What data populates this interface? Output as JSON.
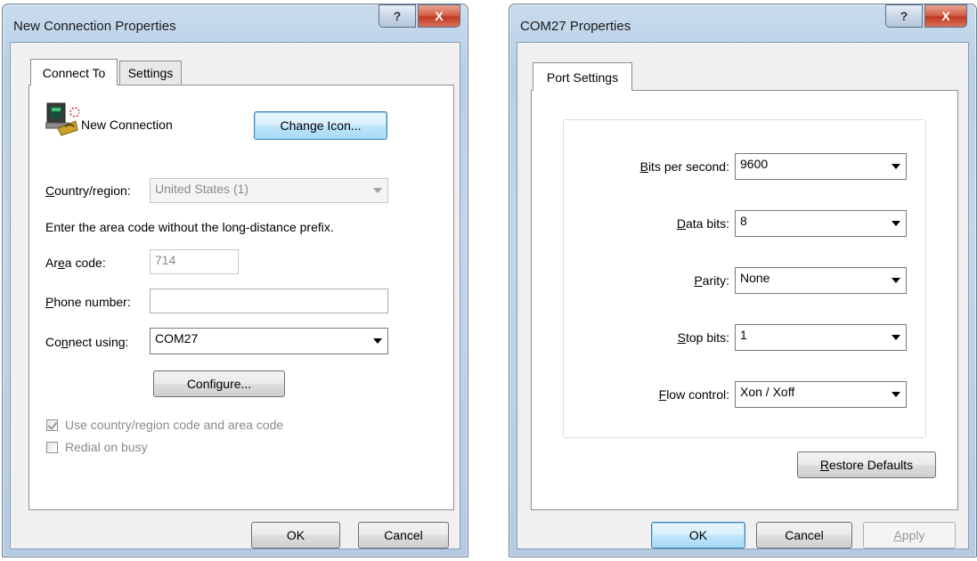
{
  "dialog1": {
    "title": "New Connection Properties",
    "help_glyph": "?",
    "close_glyph": "X",
    "tabs": [
      {
        "label": "Connect To",
        "active": true
      },
      {
        "label": "Settings",
        "active": false
      }
    ],
    "connection_icon": "phone-computer-icon",
    "connection_name": "New Connection",
    "change_icon_label": "Change Icon...",
    "country_label": "Country/region:",
    "country_value": "United States (1)",
    "instruction": "Enter the area code without the long-distance prefix.",
    "area_code_label": "Area code:",
    "area_code_value": "714",
    "phone_label": "Phone number:",
    "phone_value": "",
    "connect_using_label": "Connect using:",
    "connect_using_value": "COM27",
    "configure_label": "Configure...",
    "use_country_label": "Use country/region code and area code",
    "use_country_checked": true,
    "redial_label": "Redial on busy",
    "redial_checked": false,
    "ok_label": "OK",
    "cancel_label": "Cancel"
  },
  "dialog2": {
    "title": "COM27 Properties",
    "help_glyph": "?",
    "close_glyph": "X",
    "tab_label": "Port Settings",
    "fields": [
      {
        "label": "Bits per second:",
        "value": "9600"
      },
      {
        "label": "Data bits:",
        "value": "8"
      },
      {
        "label": "Parity:",
        "value": "None"
      },
      {
        "label": "Stop bits:",
        "value": "1"
      },
      {
        "label": "Flow control:",
        "value": "Xon / Xoff"
      }
    ],
    "restore_label": "Restore Defaults",
    "ok_label": "OK",
    "cancel_label": "Cancel",
    "apply_label": "Apply"
  }
}
